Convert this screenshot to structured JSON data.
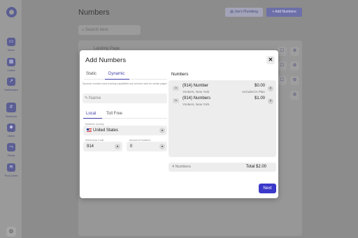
{
  "sidebar": {
    "items": [
      {
        "label": "Inbox",
        "icon": "inbox-icon"
      },
      {
        "label": "Leads",
        "icon": "leads-icon"
      },
      {
        "label": "Dashboard",
        "icon": "dashboard-icon"
      },
      {
        "label": "Numbers",
        "icon": "hash-icon"
      },
      {
        "label": "Users",
        "icon": "users-icon"
      },
      {
        "label": "Flows",
        "icon": "flows-icon"
      },
      {
        "label": "Pool Lines",
        "icon": "pool-lines-icon"
      }
    ],
    "active": "Numbers"
  },
  "header": {
    "title": "Numbers",
    "account_label": "Joe's Plumbing",
    "add_label": "Add Numbers"
  },
  "search": {
    "placeholder": "Search here"
  },
  "table": {
    "first_row_label": "Landing Page"
  },
  "modal": {
    "title": "Add Numbers",
    "close_icon": "close-icon",
    "tabs": [
      "Static",
      "Dynamic"
    ],
    "active_tab": "Dynamic",
    "description": "Dynamic numbers have tracking capabilities and are best used for certain pages",
    "name_placeholder": "Name",
    "location_tabs": [
      "Local",
      "Toll Free"
    ],
    "active_location_tab": "Local",
    "country_label": "Numbers Country",
    "country_value": "United States",
    "area_code_label": "Select Area Code",
    "area_code_value": "914",
    "amount_label": "Amount of Numbers",
    "amount_value": "0",
    "numbers_heading": "Numbers",
    "numbers": [
      {
        "index": "1x",
        "number": "(914) Number",
        "location": "Yonkers, New York",
        "price": "$0.00",
        "note": "Included in Plan"
      },
      {
        "index": "2x",
        "number": "(914) Numbers",
        "location": "Yonkers, New York",
        "price": "$1.00",
        "note": ""
      }
    ],
    "summary_count": "4 Numbers",
    "summary_total": "Total $2.00",
    "next_label": "Next"
  },
  "colors": {
    "accent": "#3d3fa8",
    "button": "#3b39c9",
    "overlay": "#8c8c8c"
  }
}
